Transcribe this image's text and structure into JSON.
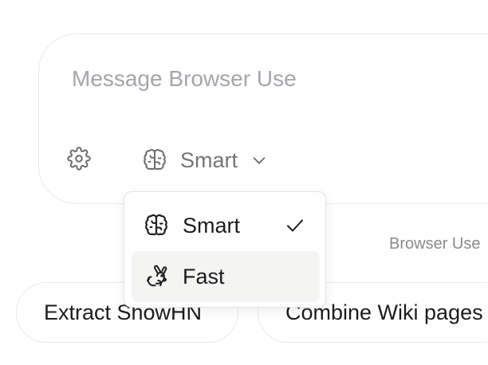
{
  "composer": {
    "placeholder": "Message Browser Use",
    "settings_icon": "gear-icon",
    "mode": {
      "selected_label": "Smart",
      "icon": "brain-icon",
      "chevron_icon": "chevron-down-icon"
    }
  },
  "mode_menu": {
    "items": [
      {
        "label": "Smart",
        "icon": "brain-icon",
        "selected": true
      },
      {
        "label": "Fast",
        "icon": "rabbit-icon",
        "selected": false
      }
    ]
  },
  "tagline": "Browser Use",
  "suggestions": [
    {
      "label": "Extract ShowHN"
    },
    {
      "label": "Combine Wiki pages"
    }
  ],
  "colors": {
    "placeholder": "#a3a6ad",
    "muted_text": "#757575",
    "border": "#e9e9e7",
    "hover_bg": "#f4f4f3"
  }
}
